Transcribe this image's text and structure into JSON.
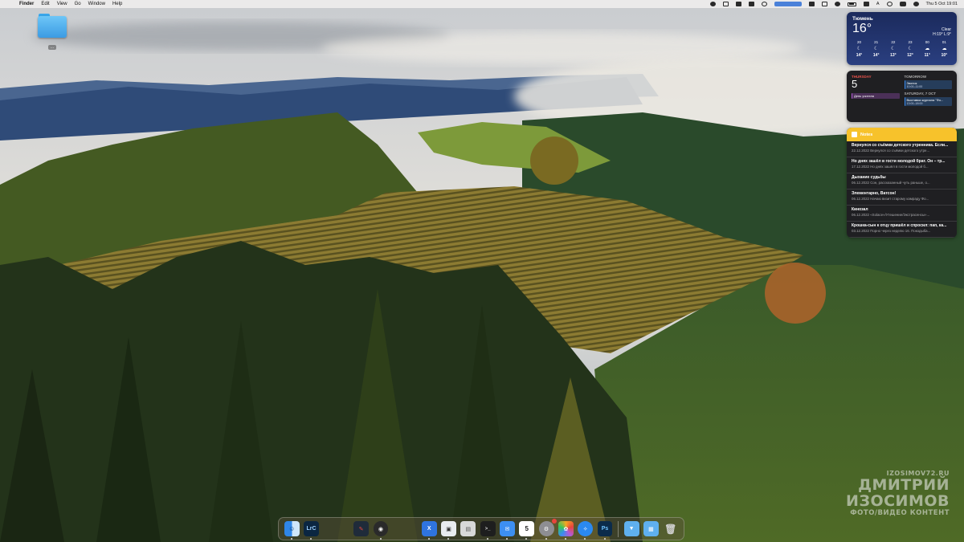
{
  "menubar": {
    "apple": "",
    "app_name": "Finder",
    "menus": [
      "Edit",
      "View",
      "Go",
      "Window",
      "Help"
    ],
    "keyboard_layout": "A",
    "datetime": "Thu 5 Oct 19:01"
  },
  "desktop": {
    "folder_label": "..."
  },
  "weather": {
    "city": "Тюмень",
    "temp": "16°",
    "condition": "Clear",
    "hi_lo": "H:19° L:9°",
    "hours": [
      {
        "time": "20",
        "icon": "moon-icon",
        "temp": "14°"
      },
      {
        "time": "21",
        "icon": "moon-icon",
        "temp": "14°"
      },
      {
        "time": "22",
        "icon": "moon-icon",
        "temp": "13°"
      },
      {
        "time": "23",
        "icon": "moon-icon",
        "temp": "12°"
      },
      {
        "time": "00",
        "icon": "cloud-moon-icon",
        "temp": "11°"
      },
      {
        "time": "01",
        "icon": "cloud-icon",
        "temp": "10°"
      }
    ]
  },
  "calendar": {
    "day_name": "THURSDAY",
    "day_num": "5",
    "today_event": "День учителя",
    "tomorrow_label": "TOMORROW",
    "tomorrow_event": "Звонок",
    "tomorrow_event_time": "10:00–11:00",
    "saturday_label": "SATURDAY, 7 OCT",
    "saturday_event": "Выставка журнала \"Фо...",
    "saturday_event_time": "13:00–18:00"
  },
  "notes": {
    "header": "Notes",
    "items": [
      {
        "title": "Вернулся со съёмки детского утренника. Если...",
        "meta": "22.12.2022  Вернулся со съёмки детского утре..."
      },
      {
        "title": "Но днях зашёл в гости молодой брат. Он – тр...",
        "meta": "17.12.2022  Но днях зашёл в гости молодой б..."
      },
      {
        "title": "Дыхание судьбы",
        "meta": "06.12.2022  Сон, рассказанный чуть раньше, о..."
      },
      {
        "title": "Элементарно, Ватсон!",
        "meta": "06.12.2022  Начаю визит старому камраду Фо..."
      },
      {
        "title": "Кинозал",
        "meta": "06.12.2022  «Solace»/Утешение/Экстрасенсы»..."
      },
      {
        "title": "Крошка-сын к отцу пришёл и спросил: пап, ка...",
        "meta": "03.12.2022  Порно через неделю 16. Покодыба..."
      }
    ]
  },
  "watermark": {
    "site": "IZOSIMOV72.RU",
    "line1": "ДМИТРИЙ",
    "line2": "ИЗОСИМОВ",
    "line3": "ФОТО/ВИДЕО КОНТЕНТ"
  },
  "dock": {
    "apps": [
      {
        "name": "finder",
        "label": "",
        "color": "#3b8fe8",
        "running": true
      },
      {
        "name": "lightroom-classic",
        "label": "LrC",
        "color": "#0b2641",
        "running": true
      },
      {
        "name": "pencil-app",
        "label": "",
        "color": "#1f2b3a",
        "running": false
      },
      {
        "name": "circle-app",
        "label": "",
        "color": "#2a2a2a",
        "running": true
      },
      {
        "name": "xcode",
        "label": "X",
        "color": "#2f74e0",
        "running": true
      },
      {
        "name": "preview",
        "label": "",
        "color": "#e9ecef",
        "running": true
      },
      {
        "name": "storage",
        "label": "",
        "color": "#d8d8d8",
        "running": false
      },
      {
        "name": "terminal",
        "label": "",
        "color": "#1e1e1e",
        "running": true
      },
      {
        "name": "mail",
        "label": "",
        "color": "#3d8ff2",
        "running": true
      },
      {
        "name": "calendar",
        "label": "5",
        "color": "#ffffff",
        "running": true
      },
      {
        "name": "system-settings",
        "label": "",
        "color": "#8e8e93",
        "running": true
      },
      {
        "name": "photos",
        "label": "",
        "color": "#f5a623",
        "running": true
      },
      {
        "name": "safari",
        "label": "",
        "color": "#2b89f0",
        "running": true
      },
      {
        "name": "photoshop",
        "label": "Ps",
        "color": "#0b2b4a",
        "running": true
      },
      {
        "name": "folder-downloads",
        "label": "",
        "color": "#5fb0ef",
        "running": false
      },
      {
        "name": "folder-documents",
        "label": "",
        "color": "#5fb0ef",
        "running": false
      },
      {
        "name": "trash",
        "label": "",
        "color": "#9a9a9a",
        "running": false
      }
    ]
  }
}
